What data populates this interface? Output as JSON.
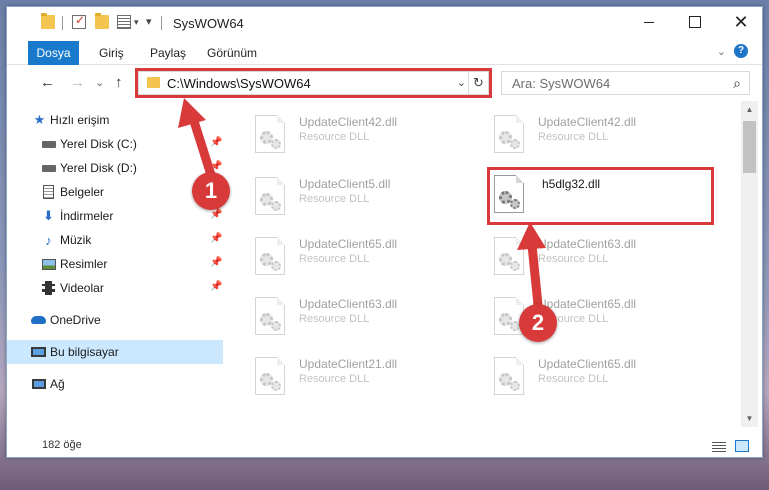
{
  "window": {
    "title": "SysWOW64",
    "controls": {
      "close": "✕"
    }
  },
  "ribbon": {
    "tabs": [
      "Dosya",
      "Giriş",
      "Paylaş",
      "Görünüm"
    ],
    "help": "?"
  },
  "navigation": {
    "back": "←",
    "forward": "→",
    "recent": "⌄",
    "up": "↑"
  },
  "address": {
    "path": "C:\\Windows\\SysWOW64",
    "refresh": "↻"
  },
  "search": {
    "placeholder": "Ara: SysWOW64"
  },
  "sidebar": {
    "items": [
      {
        "label": "Hızlı erişim",
        "icon": "star-icon"
      },
      {
        "label": "Yerel Disk (C:)",
        "icon": "drive-icon",
        "pinned": true
      },
      {
        "label": "Yerel Disk (D:)",
        "icon": "drive-icon",
        "pinned": true
      },
      {
        "label": "Belgeler",
        "icon": "documents-icon",
        "pinned": true
      },
      {
        "label": "İndirmeler",
        "icon": "download-icon",
        "pinned": true
      },
      {
        "label": "Müzik",
        "icon": "music-icon",
        "pinned": true
      },
      {
        "label": "Resimler",
        "icon": "pictures-icon",
        "pinned": true
      },
      {
        "label": "Videolar",
        "icon": "videos-icon",
        "pinned": true
      },
      {
        "label": "OneDrive",
        "icon": "cloud-icon"
      },
      {
        "label": "Bu bilgisayar",
        "icon": "computer-icon",
        "selected": true
      },
      {
        "label": "Ağ",
        "icon": "network-icon"
      }
    ]
  },
  "files": [
    {
      "name": "UpdateClient42.dll",
      "type": "Resource DLL"
    },
    {
      "name": "UpdateClient42.dll",
      "type": "Resource DLL"
    },
    {
      "name": "UpdateClient5.dll",
      "type": "Resource DLL"
    },
    {
      "name": "h5dlg32.dll",
      "type": ""
    },
    {
      "name": "UpdateClient65.dll",
      "type": "Resource DLL"
    },
    {
      "name": "UpdateClient63.dll",
      "type": "Resource DLL"
    },
    {
      "name": "UpdateClient63.dll",
      "type": "Resource DLL"
    },
    {
      "name": "UpdateClient65.dll",
      "type": "Resource DLL"
    },
    {
      "name": "UpdateClient21.dll",
      "type": "Resource DLL"
    },
    {
      "name": "UpdateClient65.dll",
      "type": "Resource DLL"
    }
  ],
  "status": {
    "item_count": "182 öğe"
  },
  "annotations": {
    "step1": "1",
    "step2": "2",
    "color": "#d83a3a"
  }
}
